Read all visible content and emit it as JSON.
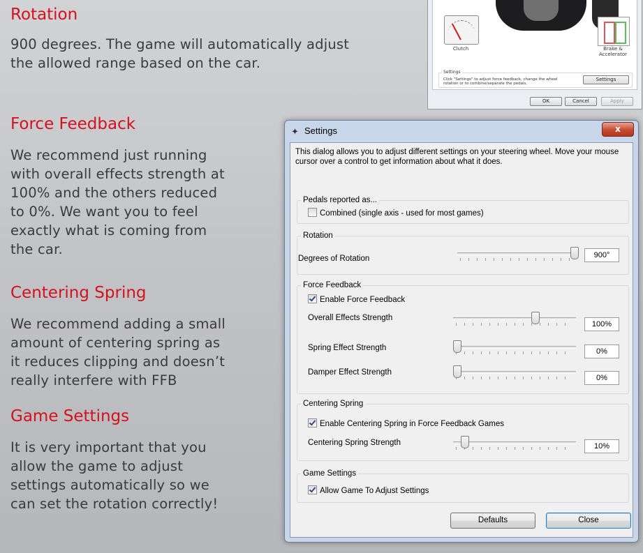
{
  "guide": {
    "sections": [
      {
        "heading": "Rotation",
        "lines": [
          "900 degrees. The game will automatically adjust",
          "the allowed range based on the car."
        ]
      },
      {
        "heading": "Force Feedback",
        "lines": [
          "We recommend just running",
          "with overall effects strength at",
          "100% and the others reduced",
          "to 0%. We want you to feel",
          "exactly what is coming from",
          "the car."
        ]
      },
      {
        "heading": "Centering Spring",
        "lines": [
          "We recommend adding a small",
          "amount of centering spring as",
          "it reduces clipping and doesn’t",
          "really interfere with FFB"
        ]
      },
      {
        "heading": "Game Settings",
        "lines": [
          "It is very important that you",
          "allow the game to adjust",
          "settings automatically so we",
          "can set the rotation correctly!"
        ]
      }
    ]
  },
  "mini_dialog": {
    "clutch_label": "Clutch",
    "brake_label_1": "Brake &",
    "brake_label_2": "Accelerator",
    "settings_caption": "Settings",
    "settings_hint_1": "Click \"Settings\" to adjust force feedback, change the wheel",
    "settings_hint_2": "rotation or to combine/separate the pedals.",
    "settings_button": "Settings",
    "ok_button": "OK",
    "cancel_button": "Cancel",
    "apply_button": "Apply"
  },
  "dialog": {
    "title": "Settings",
    "close_glyph": "x",
    "intro_1": "This dialog allows you to adjust different settings on your steering wheel.  Move your mouse",
    "intro_2": "cursor over a control to get information about what it does.",
    "pedals": {
      "legend": "Pedals reported as...",
      "combined_label": "Combined (single axis - used for most games)",
      "combined_checked": false
    },
    "rotation": {
      "legend": "Rotation",
      "label": "Degrees of Rotation",
      "value": "900°",
      "level": 1.0
    },
    "force_feedback": {
      "legend": "Force Feedback",
      "enable_label": "Enable Force Feedback",
      "enable_checked": true,
      "overall_label": "Overall Effects Strength",
      "overall_value": "100%",
      "overall_level": 0.68,
      "spring_label": "Spring Effect Strength",
      "spring_value": "0%",
      "spring_level": 0.0,
      "damper_label": "Damper Effect Strength",
      "damper_value": "0%",
      "damper_level": 0.0
    },
    "centering": {
      "legend": "Centering Spring",
      "enable_label": "Enable Centering Spring in Force Feedback Games",
      "enable_checked": true,
      "strength_label": "Centering Spring Strength",
      "strength_value": "10%",
      "strength_level": 0.07
    },
    "game_settings": {
      "legend": "Game Settings",
      "allow_label": "Allow Game To Adjust Settings",
      "allow_checked": true
    },
    "defaults_button": "Defaults",
    "close_button": "Close"
  }
}
